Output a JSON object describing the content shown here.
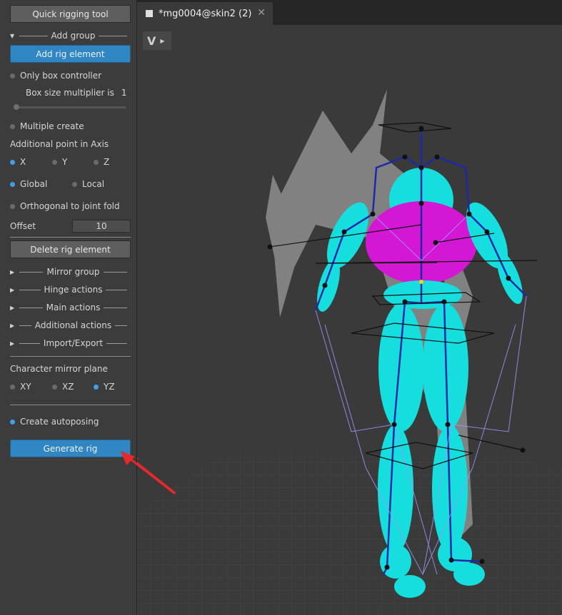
{
  "sidebar": {
    "quick_rigging_tool": "Quick rigging tool",
    "add_group": "Add group",
    "add_rig_element": "Add rig element",
    "only_box_controller": "Only box controller",
    "box_size_label": "Box size multiplier is",
    "box_size_value": "1",
    "multiple_create": "Multiple create",
    "additional_point_axis": "Additional point in Axis",
    "axis_x": "X",
    "axis_y": "Y",
    "axis_z": "Z",
    "global": "Global",
    "local": "Local",
    "orthogonal": "Orthogonal to joint fold",
    "offset_label": "Offset",
    "offset_value": "10",
    "delete_rig_element": "Delete rig element",
    "mirror_group": "Mirror group",
    "hinge_actions": "Hinge actions",
    "main_actions": "Main actions",
    "additional_actions": "Additional actions",
    "import_export": "Import/Export",
    "mirror_plane_label": "Character mirror plane",
    "plane_xy": "XY",
    "plane_xz": "XZ",
    "plane_yz": "YZ",
    "create_autoposing": "Create autoposing",
    "generate_rig": "Generate rig"
  },
  "tabbar": {
    "tab_title": "*mg0004@skin2 (2)",
    "close": "✕"
  },
  "viewport": {
    "tool_icon": "V"
  },
  "colors": {
    "accent_blue": "#2f86c2",
    "body_cyan": "#15e0e0",
    "chest_magenta": "#d417d4",
    "arrow_red": "#e8282c"
  }
}
